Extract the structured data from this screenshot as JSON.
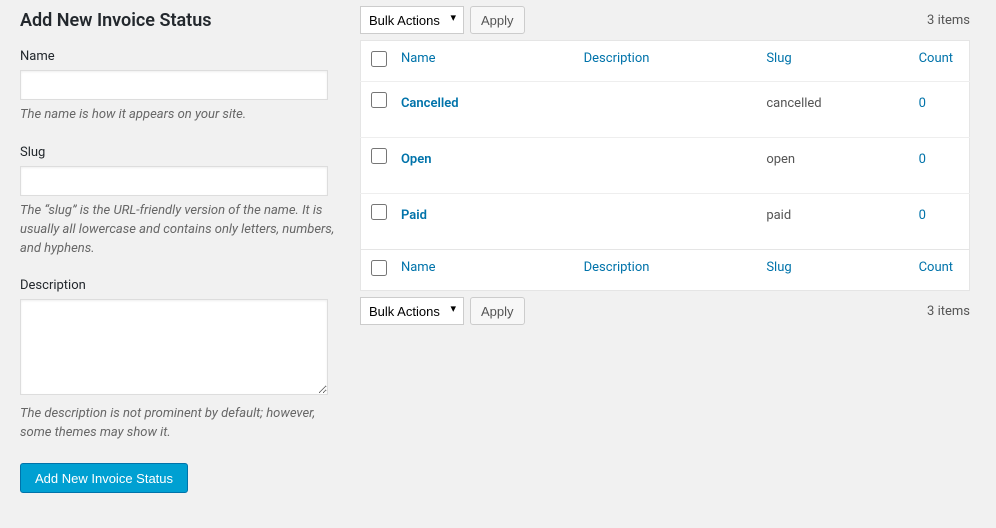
{
  "form": {
    "heading": "Add New Invoice Status",
    "name": {
      "label": "Name",
      "value": "",
      "help": "The name is how it appears on your site."
    },
    "slug": {
      "label": "Slug",
      "value": "",
      "help": "The “slug” is the URL-friendly version of the name. It is usually all lowercase and contains only letters, numbers, and hyphens."
    },
    "description": {
      "label": "Description",
      "value": "",
      "help": "The description is not prominent by default; however, some themes may show it."
    },
    "submit": "Add New Invoice Status"
  },
  "tablenav": {
    "bulk_label": "Bulk Actions",
    "apply": "Apply",
    "count_text": "3 items"
  },
  "columns": {
    "name": "Name",
    "description": "Description",
    "slug": "Slug",
    "count": "Count"
  },
  "rows": [
    {
      "name": "Cancelled",
      "description": "",
      "slug": "cancelled",
      "count": "0"
    },
    {
      "name": "Open",
      "description": "",
      "slug": "open",
      "count": "0"
    },
    {
      "name": "Paid",
      "description": "",
      "slug": "paid",
      "count": "0"
    }
  ]
}
